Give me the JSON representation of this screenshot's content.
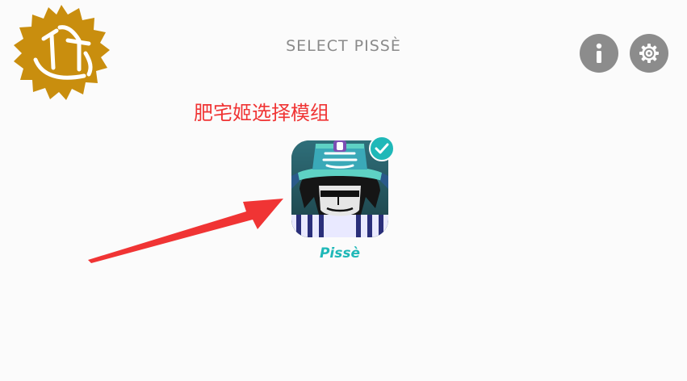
{
  "header": {
    "title": "SELECT PISSÈ"
  },
  "buttons": {
    "info_icon": "info-icon",
    "settings_icon": "gear-icon"
  },
  "annotation": {
    "text": "肥宅姬选择模组",
    "color": "#f03434"
  },
  "mods": [
    {
      "label": "Pissè",
      "selected": true
    }
  ],
  "colors": {
    "accent": "#1fb8b8",
    "button_gray": "#8c8c8c",
    "title_gray": "#8a8a8a",
    "badge_gold": "#c98e0e"
  }
}
